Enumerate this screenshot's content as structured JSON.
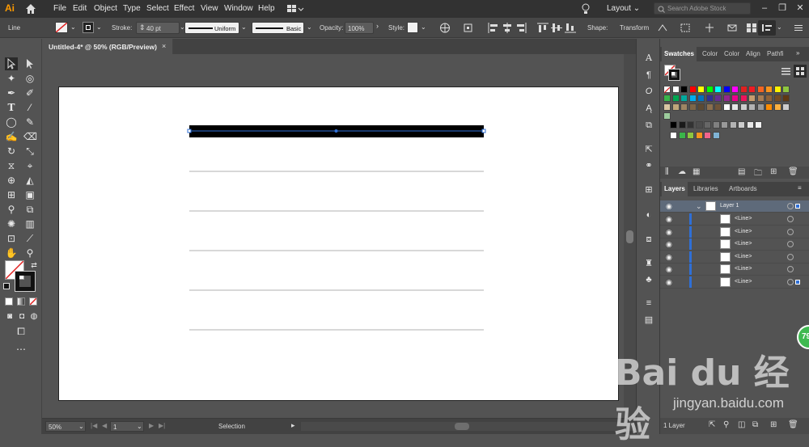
{
  "app": {
    "logo": "Ai",
    "menu": [
      "File",
      "Edit",
      "Object",
      "Type",
      "Select",
      "Effect",
      "View",
      "Window",
      "Help"
    ],
    "workspace": "Layout",
    "search_placeholder": "Search Adobe Stock"
  },
  "control_bar": {
    "selection_type": "Line",
    "stroke_label": "Stroke:",
    "stroke_weight": "40 pt",
    "profile": "Uniform",
    "brush": "Basic",
    "opacity_label": "Opacity:",
    "opacity": "100%",
    "style_label": "Style:",
    "shape_label": "Shape:",
    "transform_label": "Transform"
  },
  "document": {
    "tab_title": "Untitled-4* @ 50% (RGB/Preview)",
    "close_symbol": "×"
  },
  "status_bar": {
    "zoom": "50%",
    "artboard_num": "1",
    "tool": "Selection"
  },
  "swatches_panel": {
    "tabs": [
      "Swatches",
      "Color",
      "Color",
      "Align",
      "Pathfi"
    ]
  },
  "layers_panel": {
    "tabs": [
      "Layers",
      "Libraries",
      "Artboards"
    ],
    "layer_name": "Layer 1",
    "sublayers": [
      "<Line>",
      "<Line>",
      "<Line>",
      "<Line>",
      "<Line>",
      "<Line>"
    ],
    "footer": "1 Layer"
  },
  "colors": {
    "selection_blue": "#2f6fd6",
    "accent_orange": "#ff9a00"
  },
  "watermark": {
    "text": "Bai du 经验",
    "url": "jingyan.baidu.com",
    "badge": "79"
  }
}
